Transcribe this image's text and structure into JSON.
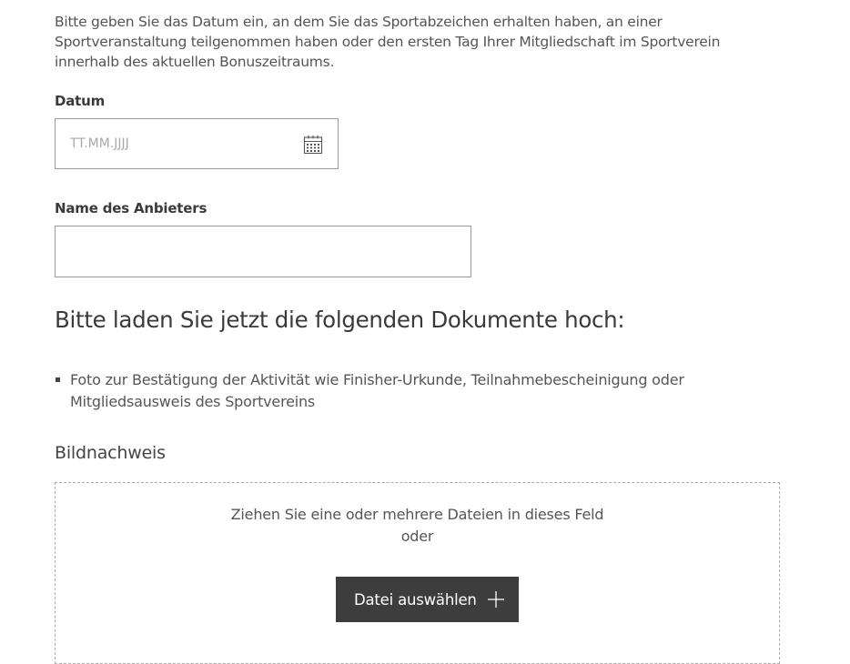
{
  "intro": {
    "text": "Bitte geben Sie das Datum ein, an dem Sie das Sportabzeichen erhalten haben, an einer Sportveranstaltung teilgenommen haben oder den ersten Tag Ihrer Mitgliedschaft im Sportverein innerhalb des aktuellen Bonuszeitraums."
  },
  "date": {
    "label": "Datum",
    "placeholder": "TT.MM.JJJJ",
    "value": "",
    "icon": "calendar-icon"
  },
  "provider": {
    "label": "Name des Anbieters",
    "value": ""
  },
  "upload": {
    "heading": "Bitte laden Sie jetzt die folgenden Dokumente hoch:",
    "documents": [
      "Foto zur Bestätigung der Aktivität wie Finisher-Urkunde, Teilnahmebescheinigung oder Mitgliedsausweis des Sportvereins"
    ],
    "section_title": "Bildnachweis",
    "drop_text": "Ziehen Sie eine oder mehrere Dateien in dieses Feld",
    "or_text": "oder",
    "button_label": "Datei auswählen",
    "button_icon": "plus-icon"
  },
  "colors": {
    "text": "#3a3a3a",
    "muted_text": "#555555",
    "border": "#999999",
    "button_bg": "#3d3d3d",
    "button_text": "#ffffff"
  }
}
